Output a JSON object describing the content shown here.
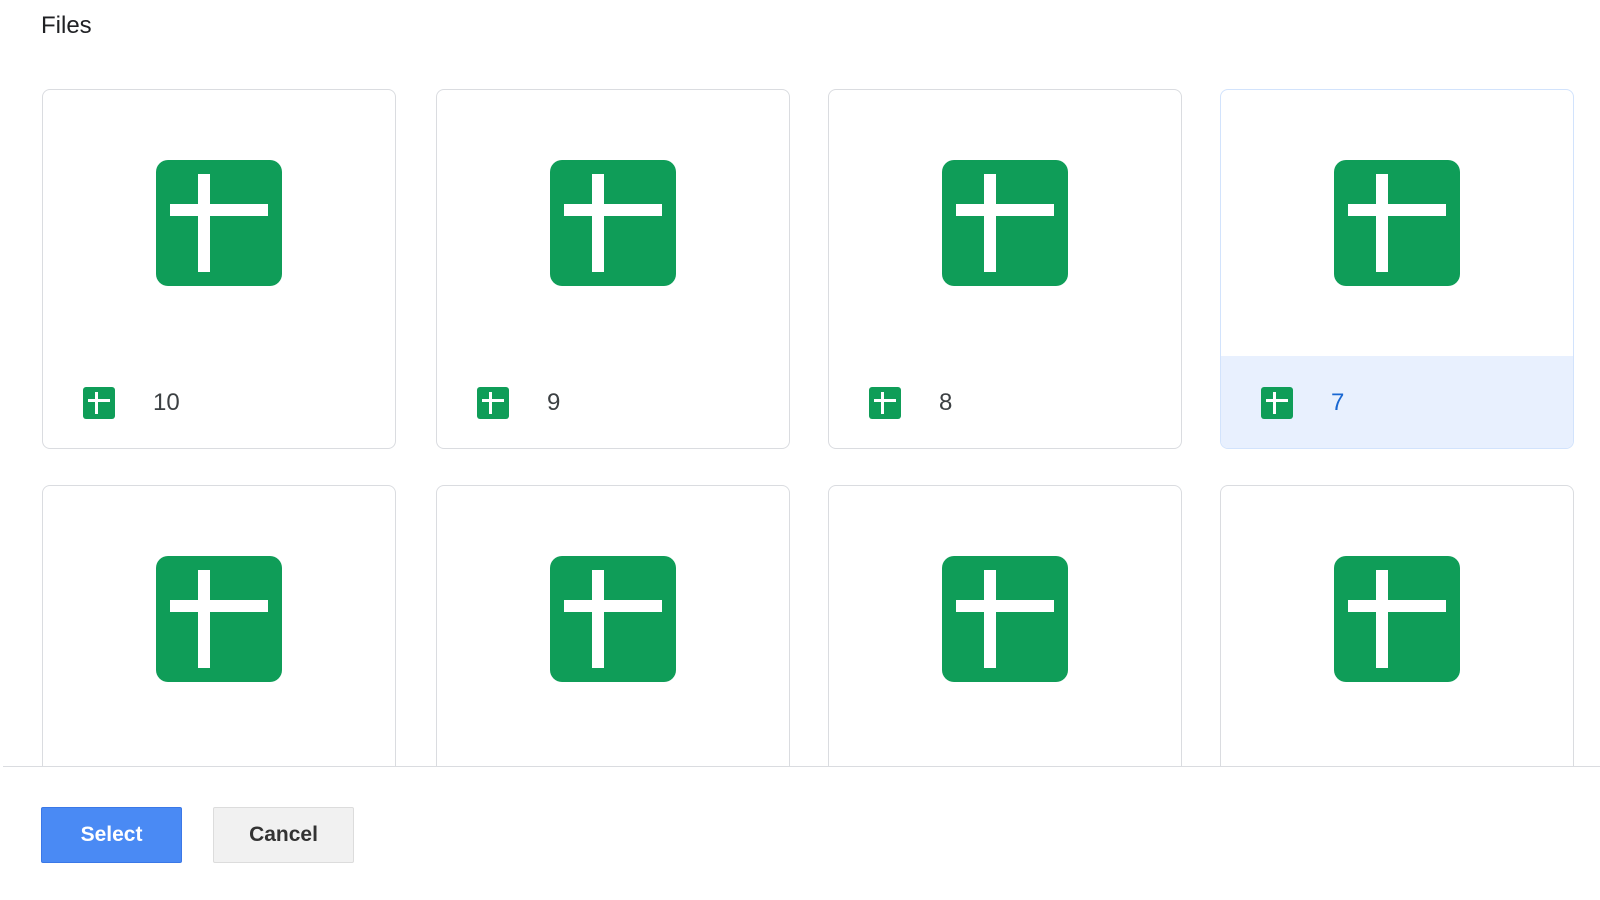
{
  "header": {
    "title": "Files"
  },
  "files": [
    {
      "name": "10",
      "icon": "spreadsheet-icon",
      "selected": false
    },
    {
      "name": "9",
      "icon": "spreadsheet-icon",
      "selected": false
    },
    {
      "name": "8",
      "icon": "spreadsheet-icon",
      "selected": false
    },
    {
      "name": "7",
      "icon": "spreadsheet-icon",
      "selected": true
    },
    {
      "name": "",
      "icon": "spreadsheet-icon",
      "selected": false
    },
    {
      "name": "",
      "icon": "spreadsheet-icon",
      "selected": false
    },
    {
      "name": "",
      "icon": "spreadsheet-icon",
      "selected": false
    },
    {
      "name": "",
      "icon": "spreadsheet-icon",
      "selected": false
    }
  ],
  "actions": {
    "select_label": "Select",
    "cancel_label": "Cancel"
  },
  "colors": {
    "icon_green": "#0f9d58",
    "selected_background": "#e8f0fe",
    "selected_text": "#1967d2",
    "primary_button": "#4a8af4"
  }
}
